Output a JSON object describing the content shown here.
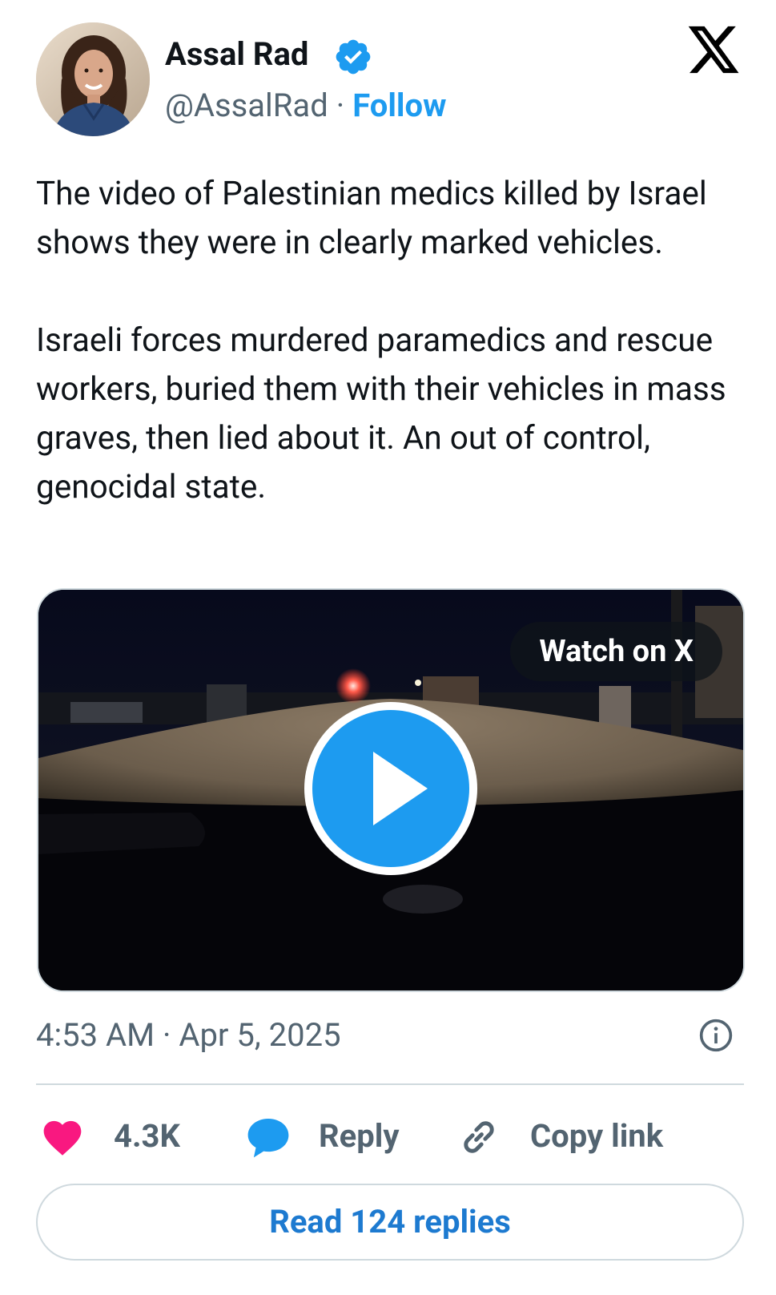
{
  "author": {
    "display_name": "Assal Rad",
    "handle": "@AssalRad",
    "separator": "·",
    "follow_label": "Follow",
    "verified": true
  },
  "brand": {
    "logo_icon": "x-logo-icon",
    "color": "#000000"
  },
  "tweet": {
    "paragraphs": [
      "The video of Palestinian medics killed by Israel shows they were in clearly marked vehicles.",
      "Israeli forces murdered paramedics and rescue workers, buried them with their vehicles in mass graves, then lied about it. An out of control, genocidal state."
    ]
  },
  "media": {
    "watch_label": "Watch on X",
    "play_icon": "play-icon"
  },
  "meta": {
    "timestamp": "4:53 AM · Apr 5, 2025",
    "info_icon": "info-icon"
  },
  "actions": {
    "like_count": "4.3K",
    "reply_label": "Reply",
    "copy_label": "Copy link"
  },
  "footer": {
    "read_replies_label": "Read 124 replies"
  },
  "colors": {
    "accent": "#1d9bf0",
    "like": "#f91880",
    "secondary_text": "#536471",
    "border": "#cfd9de"
  }
}
